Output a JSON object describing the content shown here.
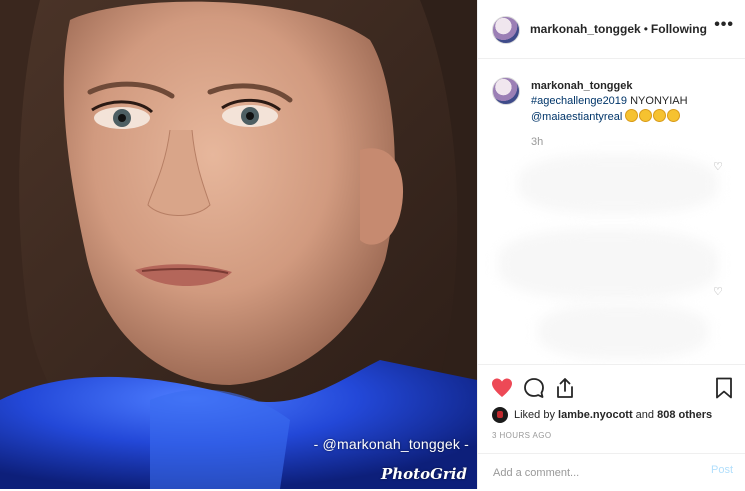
{
  "photo": {
    "watermark_handle": "- @markonah_tonggek -",
    "watermark_brand": "PhotoGrid"
  },
  "header": {
    "username": "markonah_tonggek",
    "separator": "•",
    "follow_status": "Following",
    "more_label": "•••"
  },
  "caption": {
    "username": "markonah_tonggek",
    "hashtag": "#agechallenge2019",
    "text": " NYONYIAH ",
    "mention": "@maiaestiantyreal",
    "emoji_count": 4,
    "time_ago": "3h"
  },
  "actions": {
    "liked_by_prefix": "Liked by ",
    "liked_by_user": "lambe.nyocott",
    "liked_by_suffix": " and ",
    "others": "808 others",
    "date": "3 HOURS AGO"
  },
  "comment": {
    "placeholder": "Add a comment...",
    "post_label": "Post"
  },
  "colors": {
    "like_red": "#ed4956",
    "link_blue": "#003569",
    "post_disabled": "#b2dffc"
  }
}
